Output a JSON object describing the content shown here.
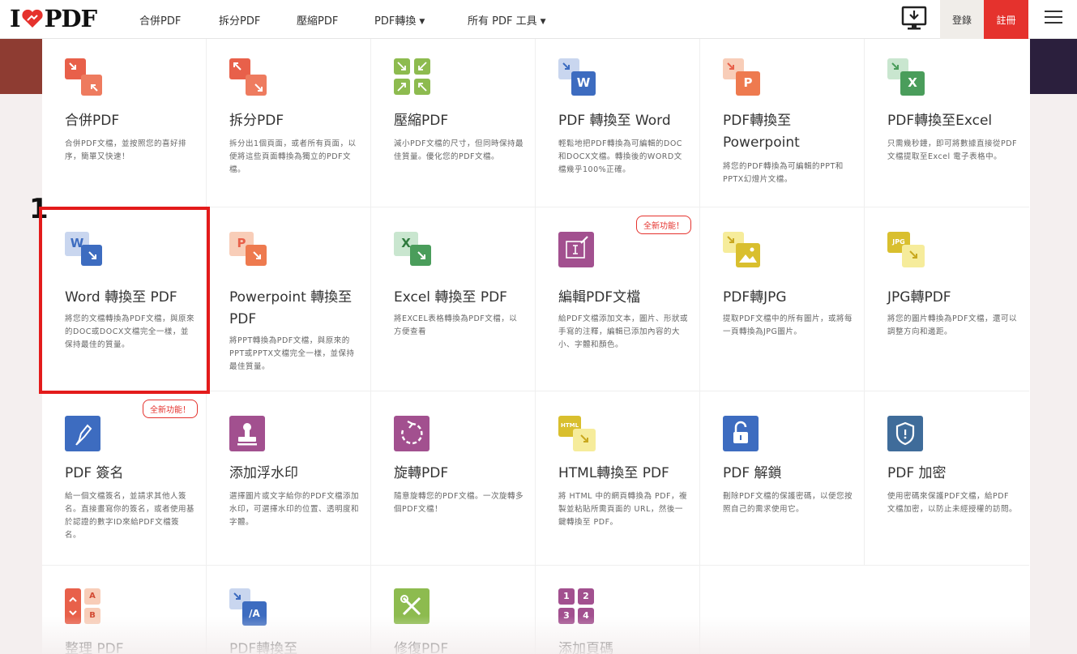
{
  "logo": {
    "left": "I",
    "right": "PDF"
  },
  "nav": {
    "merge": "合併PDF",
    "split": "拆分PDF",
    "compress": "壓縮PDF",
    "convert": "PDF轉換",
    "all_tools": "所有 PDF 工具"
  },
  "header": {
    "login": "登錄",
    "signup": "註冊"
  },
  "annotation": {
    "number": "1"
  },
  "badges": {
    "new": "全新功能！"
  },
  "tools": [
    {
      "title": "合併PDF",
      "desc": "合併PDF文檔，並按照您的喜好排序，簡單又快速！"
    },
    {
      "title": "拆分PDF",
      "desc": "拆分出1個頁面，或者所有頁面，以便將這些頁面轉換為獨立的PDF文檔。"
    },
    {
      "title": "壓縮PDF",
      "desc": "減小PDF文檔的尺寸，但同時保持最佳質量。優化您的PDF文檔。"
    },
    {
      "title": "PDF 轉換至 Word",
      "desc": "輕鬆地把PDF轉換為可編輯的DOC和DOCX文檔。轉換後的WORD文檔幾乎100%正確。"
    },
    {
      "title": "PDF轉換至Powerpoint",
      "desc": "將您的PDF轉換為可編輯的PPT和PPTX幻燈片文檔。"
    },
    {
      "title": "PDF轉換至Excel",
      "desc": "只需幾秒鐘，即可將數據直接從PDF文檔提取至Excel 電子表格中。"
    },
    {
      "title": "Word 轉換至 PDF",
      "desc": "將您的文檔轉換為PDF文檔，與原來的DOC或DOCX文檔完全一樣，並保持最佳的質量。"
    },
    {
      "title": "Powerpoint 轉換至 PDF",
      "desc": "將PPT轉換為PDF文檔，與原來的PPT或PPTX文檔完全一樣，並保持最佳質量。"
    },
    {
      "title": "Excel 轉換至 PDF",
      "desc": "將EXCEL表格轉換為PDF文檔，以方便查看"
    },
    {
      "title": "編輯PDF文檔",
      "desc": "給PDF文檔添加文本，圖片、形狀或手寫的注釋，編輯已添加內容的大小、字體和顏色。"
    },
    {
      "title": "PDF轉JPG",
      "desc": "提取PDF文檔中的所有圖片，或將每一頁轉換為JPG圖片。"
    },
    {
      "title": "JPG轉PDF",
      "desc": "將您的圖片轉換為PDF文檔，還可以調整方向和邊距。"
    },
    {
      "title": "PDF 簽名",
      "desc": "給一個文檔簽名，並請求其他人簽名。直接畫寫你的簽名，或者使用基於認證的數字ID來給PDF文檔簽名。"
    },
    {
      "title": "添加浮水印",
      "desc": "選擇圖片或文字給你的PDF文檔添加水印，可選擇水印的位置、透明度和字體。"
    },
    {
      "title": "旋轉PDF",
      "desc": "隨意旋轉您的PDF文檔。一次旋轉多個PDF文檔！"
    },
    {
      "title": "HTML轉換至 PDF",
      "desc": "將 HTML 中的網頁轉換為 PDF，複製並粘貼所需頁面的 URL，然後一鍵轉換至 PDF。"
    },
    {
      "title": "PDF 解鎖",
      "desc": "刪除PDF文檔的保護密碼，以便您按照自己的需求使用它。"
    },
    {
      "title": "PDF 加密",
      "desc": "使用密碼來保護PDF文檔，給PDF文檔加密，以防止未經授權的訪問。"
    },
    {
      "title": "整理 PDF",
      "desc": ""
    },
    {
      "title": "PDF轉換至",
      "desc": ""
    },
    {
      "title": "修復PDF",
      "desc": ""
    },
    {
      "title": "添加頁碼",
      "desc": ""
    }
  ],
  "icon_labels": {
    "word": "W",
    "ppt": "P",
    "excel": "X",
    "html": "HTML",
    "jpg": "JPG",
    "pdfa": "/A",
    "org_a": "A",
    "org_b": "B",
    "n1": "1",
    "n2": "2",
    "n3": "3",
    "n4": "4"
  },
  "colors": {
    "accent": "#e5322d",
    "highlight": "#e31b1b"
  }
}
